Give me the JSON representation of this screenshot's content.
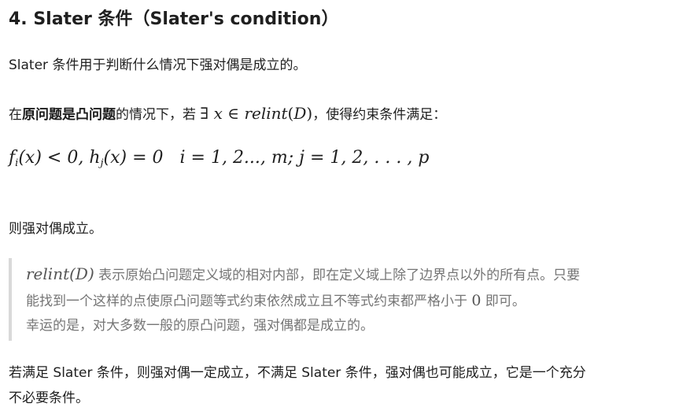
{
  "heading": "4. Slater 条件（Slater's condition）",
  "intro": "Slater 条件用于判断什么情况下强对偶是成立的。",
  "condition": {
    "prefix": "在",
    "bold": "原问题是凸问题",
    "middle": "的情况下，若",
    "exists_symbol": "∃",
    "var_x": "x",
    "in_symbol": "∈",
    "relint": "relint",
    "open_paren": "(",
    "domain": "D",
    "close_paren": ")",
    "suffix": "，使得约束条件满足："
  },
  "formula": {
    "f": "f",
    "i_sub": "i",
    "lt_zero": "(x) < 0,",
    "h": "h",
    "j_sub": "j",
    "eq_zero": "(x) = 0",
    "i_range": "i = 1, 2..., m; j = 1, 2, . . . , p"
  },
  "conclusion": "则强对偶成立。",
  "quote": {
    "line1_math": "relint(D)",
    "line1_text": " 表示原始凸问题定义域的相对内部，即在定义域上除了边界点以外的所有点。只要",
    "line2_text_a": "能找到一个这样的点使原凸问题等式约束依然成立且不等式约束都严格小于 ",
    "line2_zero": "0",
    "line2_text_b": " 即可。",
    "line3": "幸运的是，对大多数一般的原凸问题，强对偶都是成立的。"
  },
  "footer_line1": "若满足 Slater 条件，则强对偶一定成立，不满足 Slater 条件，强对偶也可能成立，它是一个充分",
  "footer_line2": "不必要条件。"
}
